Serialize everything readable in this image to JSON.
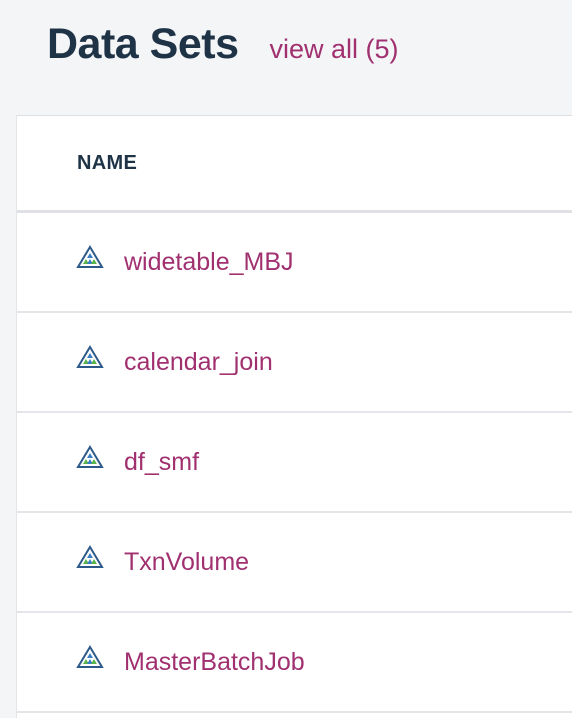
{
  "header": {
    "title": "Data Sets",
    "view_all": "view all (5)"
  },
  "table": {
    "column_header": "NAME",
    "rows": [
      {
        "name": "widetable_MBJ",
        "icon": "dataset-icon"
      },
      {
        "name": "calendar_join",
        "icon": "dataset-icon"
      },
      {
        "name": "df_smf",
        "icon": "dataset-icon"
      },
      {
        "name": "TxnVolume",
        "icon": "dataset-icon"
      },
      {
        "name": "MasterBatchJob",
        "icon": "dataset-icon"
      }
    ]
  },
  "colors": {
    "title": "#1f3347",
    "link": "#a0306f",
    "background": "#f4f5f7",
    "panel": "#ffffff",
    "icon_outline": "#2e5a8a",
    "icon_green": "#57b34a",
    "icon_blue": "#3a7fc4"
  }
}
